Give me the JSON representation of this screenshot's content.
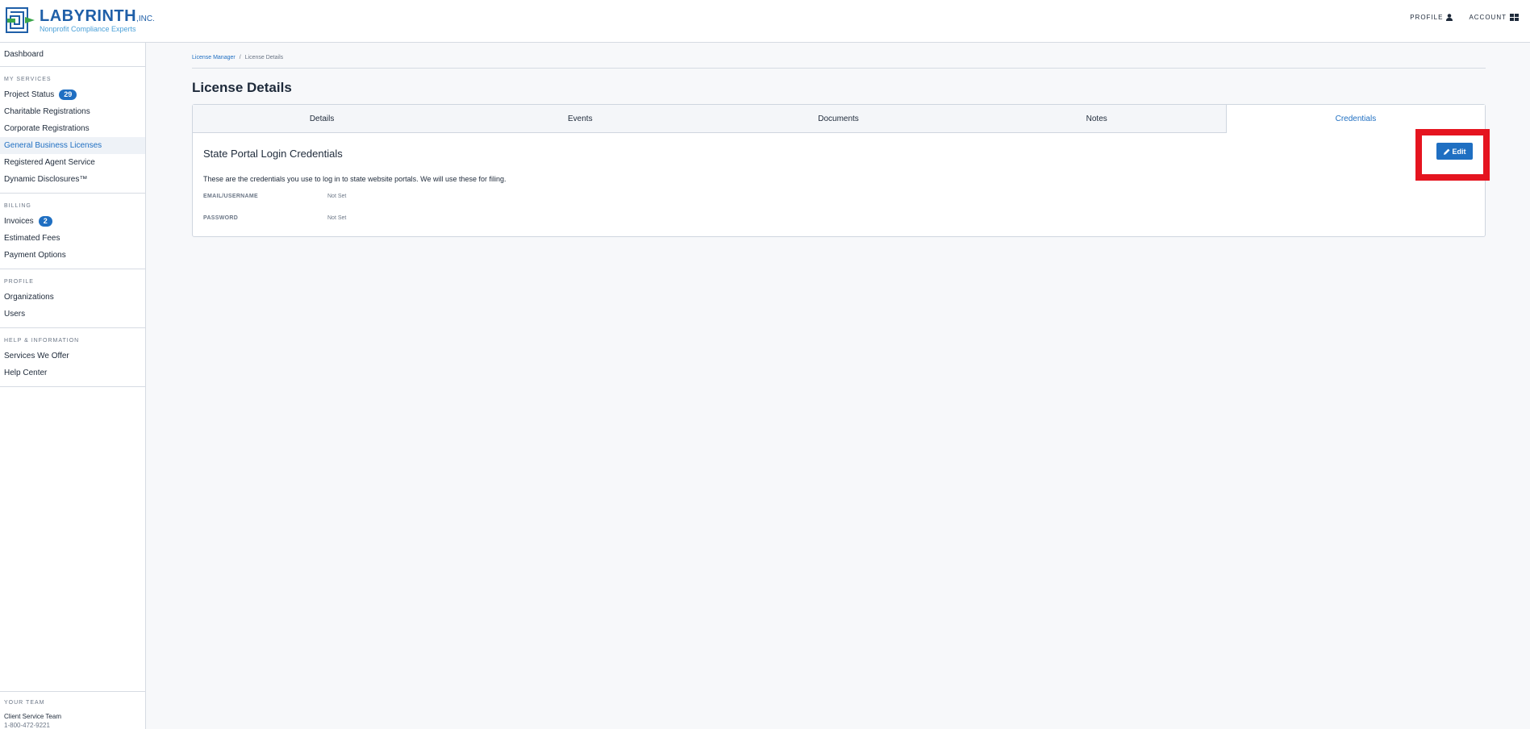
{
  "brand": {
    "name": "LABYRINTH",
    "suffix": ",INC.",
    "tagline": "Nonprofit Compliance Experts"
  },
  "header": {
    "profile_label": "PROFILE",
    "account_label": "ACCOUNT"
  },
  "sidebar": {
    "dashboard": "Dashboard",
    "sections": {
      "services": {
        "heading": "MY SERVICES",
        "items": [
          {
            "label": "Project Status",
            "badge": "29"
          },
          {
            "label": "Charitable Registrations"
          },
          {
            "label": "Corporate Registrations"
          },
          {
            "label": "General Business Licenses"
          },
          {
            "label": "Registered Agent Service"
          },
          {
            "label": "Dynamic Disclosures™"
          }
        ]
      },
      "billing": {
        "heading": "BILLING",
        "items": [
          {
            "label": "Invoices",
            "badge": "2"
          },
          {
            "label": "Estimated Fees"
          },
          {
            "label": "Payment Options"
          }
        ]
      },
      "profile": {
        "heading": "PROFILE",
        "items": [
          {
            "label": "Organizations"
          },
          {
            "label": "Users"
          }
        ]
      },
      "help": {
        "heading": "HELP & INFORMATION",
        "items": [
          {
            "label": "Services We Offer"
          },
          {
            "label": "Help Center"
          }
        ]
      }
    },
    "team": {
      "heading": "YOUR TEAM",
      "name": "Client Service Team",
      "phone": "1-800-472-9221"
    }
  },
  "breadcrumb": {
    "parent": "License Manager",
    "separator": "/",
    "current": "License Details"
  },
  "page": {
    "title": "License Details"
  },
  "tabs": [
    "Details",
    "Events",
    "Documents",
    "Notes",
    "Credentials"
  ],
  "credentials": {
    "title": "State Portal Login Credentials",
    "description": "These are the credentials you use to log in to state website portals. We will use these for filing.",
    "fields": [
      {
        "label": "EMAIL/USERNAME",
        "value": "Not Set"
      },
      {
        "label": "PASSWORD",
        "value": "Not Set"
      }
    ],
    "edit_label": "Edit"
  },
  "colors": {
    "accent": "#1f6fc2",
    "highlight": "#e5141f",
    "logo_green": "#3aa64a"
  }
}
